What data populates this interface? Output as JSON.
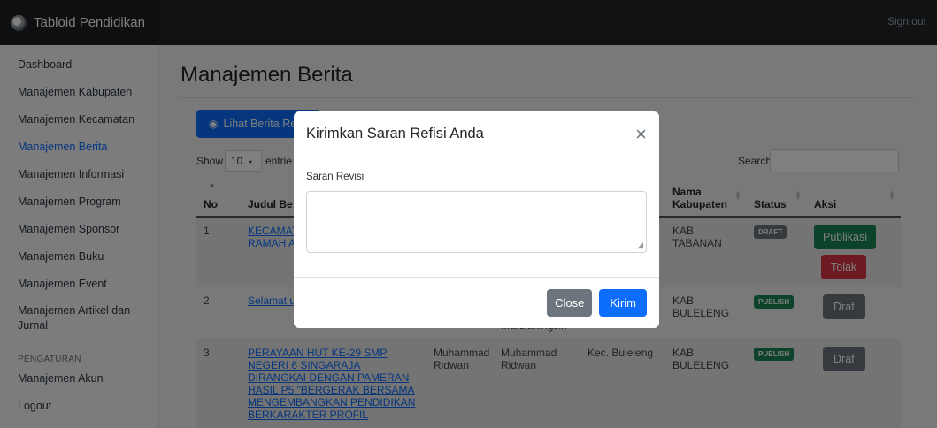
{
  "app": {
    "brand": "Tabloid Pendidikan",
    "sign_out": "Sign out"
  },
  "sidebar": {
    "items": [
      {
        "label": "Dashboard"
      },
      {
        "label": "Manajemen Kabupaten"
      },
      {
        "label": "Manajemen Kecamatan"
      },
      {
        "label": "Manajemen Berita",
        "active": true
      },
      {
        "label": "Manajemen Informasi"
      },
      {
        "label": "Manajemen Program"
      },
      {
        "label": "Manajemen Sponsor"
      },
      {
        "label": "Manajemen Buku"
      },
      {
        "label": "Manajemen Event"
      },
      {
        "label": "Manajemen Artikel dan Jurnal"
      }
    ],
    "settings_heading": "PENGATURAN",
    "settings_items": [
      {
        "label": "Manajemen Akun"
      },
      {
        "label": "Logout"
      }
    ]
  },
  "main": {
    "title": "Manajemen Berita",
    "view_button": "Lihat Berita Re",
    "show_label": "Show",
    "show_value": "10",
    "show_after": "entrie",
    "search_label": "Search:"
  },
  "table": {
    "headers": [
      "No",
      "Judul Be",
      "",
      "",
      "",
      "Nama Kabupaten",
      "Status",
      "Aksi"
    ],
    "rows": [
      {
        "no": "1",
        "title": "KECAMATA SEKOLAH ADAKAN RAMAH A",
        "col3": "",
        "col4": "",
        "col5": "g",
        "kabupaten": "KAB TABANAN",
        "status": "DRAFT",
        "action1": "Publikasi",
        "action2": "Tolak"
      },
      {
        "no": "2",
        "title": "Selamat u Paket Agu",
        "col3": "",
        "col4": "Mardianingsih",
        "col5": "",
        "kabupaten": "KAB BULELENG",
        "status": "PUBLISH",
        "action1": "Draf"
      },
      {
        "no": "3",
        "title": "PERAYAAN HUT KE-29 SMP NEGERI 6 SINGARAJA DIRANGKAI DENGAN PAMERAN HASIL P5 \"BERGERAK BERSAMA MENGEMBANGKAN PENDIDIKAN BERKARAKTER PROFIL",
        "col3": "Muhammad Ridwan",
        "col4": "Muhammad Ridwan",
        "col5": "Kec. Buleleng",
        "kabupaten": "KAB BULELENG",
        "status": "PUBLISH",
        "action1": "Draf"
      }
    ]
  },
  "modal": {
    "title": "Kirimkan Saran Refisi Anda",
    "close_symbol": "×",
    "field_label": "Saran Revisi",
    "field_value": "",
    "close_button": "Close",
    "submit_button": "Kirim"
  }
}
